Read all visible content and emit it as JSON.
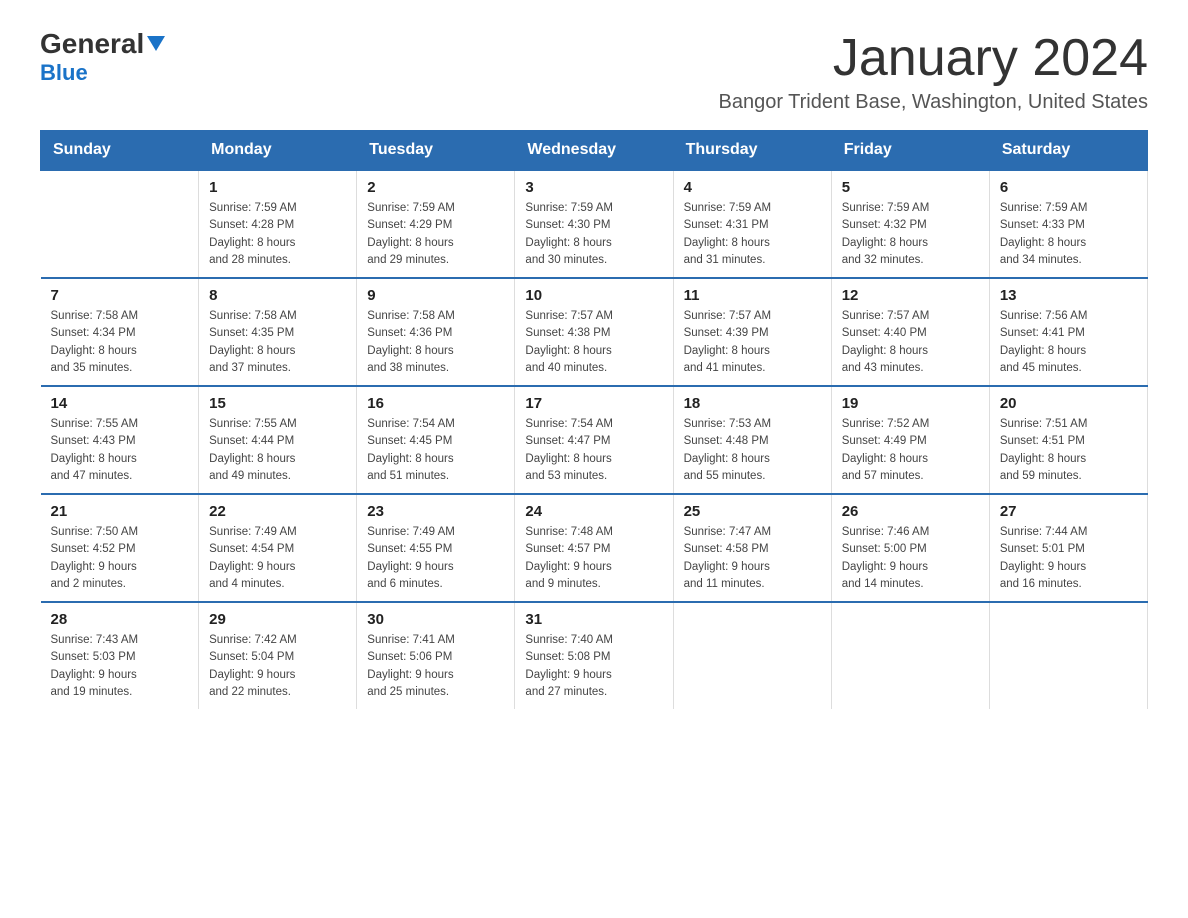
{
  "logo": {
    "part1": "General",
    "part2": "Blue"
  },
  "header": {
    "title": "January 2024",
    "subtitle": "Bangor Trident Base, Washington, United States"
  },
  "weekdays": [
    "Sunday",
    "Monday",
    "Tuesday",
    "Wednesday",
    "Thursday",
    "Friday",
    "Saturday"
  ],
  "weeks": [
    [
      {
        "day": "",
        "info": ""
      },
      {
        "day": "1",
        "info": "Sunrise: 7:59 AM\nSunset: 4:28 PM\nDaylight: 8 hours\nand 28 minutes."
      },
      {
        "day": "2",
        "info": "Sunrise: 7:59 AM\nSunset: 4:29 PM\nDaylight: 8 hours\nand 29 minutes."
      },
      {
        "day": "3",
        "info": "Sunrise: 7:59 AM\nSunset: 4:30 PM\nDaylight: 8 hours\nand 30 minutes."
      },
      {
        "day": "4",
        "info": "Sunrise: 7:59 AM\nSunset: 4:31 PM\nDaylight: 8 hours\nand 31 minutes."
      },
      {
        "day": "5",
        "info": "Sunrise: 7:59 AM\nSunset: 4:32 PM\nDaylight: 8 hours\nand 32 minutes."
      },
      {
        "day": "6",
        "info": "Sunrise: 7:59 AM\nSunset: 4:33 PM\nDaylight: 8 hours\nand 34 minutes."
      }
    ],
    [
      {
        "day": "7",
        "info": "Sunrise: 7:58 AM\nSunset: 4:34 PM\nDaylight: 8 hours\nand 35 minutes."
      },
      {
        "day": "8",
        "info": "Sunrise: 7:58 AM\nSunset: 4:35 PM\nDaylight: 8 hours\nand 37 minutes."
      },
      {
        "day": "9",
        "info": "Sunrise: 7:58 AM\nSunset: 4:36 PM\nDaylight: 8 hours\nand 38 minutes."
      },
      {
        "day": "10",
        "info": "Sunrise: 7:57 AM\nSunset: 4:38 PM\nDaylight: 8 hours\nand 40 minutes."
      },
      {
        "day": "11",
        "info": "Sunrise: 7:57 AM\nSunset: 4:39 PM\nDaylight: 8 hours\nand 41 minutes."
      },
      {
        "day": "12",
        "info": "Sunrise: 7:57 AM\nSunset: 4:40 PM\nDaylight: 8 hours\nand 43 minutes."
      },
      {
        "day": "13",
        "info": "Sunrise: 7:56 AM\nSunset: 4:41 PM\nDaylight: 8 hours\nand 45 minutes."
      }
    ],
    [
      {
        "day": "14",
        "info": "Sunrise: 7:55 AM\nSunset: 4:43 PM\nDaylight: 8 hours\nand 47 minutes."
      },
      {
        "day": "15",
        "info": "Sunrise: 7:55 AM\nSunset: 4:44 PM\nDaylight: 8 hours\nand 49 minutes."
      },
      {
        "day": "16",
        "info": "Sunrise: 7:54 AM\nSunset: 4:45 PM\nDaylight: 8 hours\nand 51 minutes."
      },
      {
        "day": "17",
        "info": "Sunrise: 7:54 AM\nSunset: 4:47 PM\nDaylight: 8 hours\nand 53 minutes."
      },
      {
        "day": "18",
        "info": "Sunrise: 7:53 AM\nSunset: 4:48 PM\nDaylight: 8 hours\nand 55 minutes."
      },
      {
        "day": "19",
        "info": "Sunrise: 7:52 AM\nSunset: 4:49 PM\nDaylight: 8 hours\nand 57 minutes."
      },
      {
        "day": "20",
        "info": "Sunrise: 7:51 AM\nSunset: 4:51 PM\nDaylight: 8 hours\nand 59 minutes."
      }
    ],
    [
      {
        "day": "21",
        "info": "Sunrise: 7:50 AM\nSunset: 4:52 PM\nDaylight: 9 hours\nand 2 minutes."
      },
      {
        "day": "22",
        "info": "Sunrise: 7:49 AM\nSunset: 4:54 PM\nDaylight: 9 hours\nand 4 minutes."
      },
      {
        "day": "23",
        "info": "Sunrise: 7:49 AM\nSunset: 4:55 PM\nDaylight: 9 hours\nand 6 minutes."
      },
      {
        "day": "24",
        "info": "Sunrise: 7:48 AM\nSunset: 4:57 PM\nDaylight: 9 hours\nand 9 minutes."
      },
      {
        "day": "25",
        "info": "Sunrise: 7:47 AM\nSunset: 4:58 PM\nDaylight: 9 hours\nand 11 minutes."
      },
      {
        "day": "26",
        "info": "Sunrise: 7:46 AM\nSunset: 5:00 PM\nDaylight: 9 hours\nand 14 minutes."
      },
      {
        "day": "27",
        "info": "Sunrise: 7:44 AM\nSunset: 5:01 PM\nDaylight: 9 hours\nand 16 minutes."
      }
    ],
    [
      {
        "day": "28",
        "info": "Sunrise: 7:43 AM\nSunset: 5:03 PM\nDaylight: 9 hours\nand 19 minutes."
      },
      {
        "day": "29",
        "info": "Sunrise: 7:42 AM\nSunset: 5:04 PM\nDaylight: 9 hours\nand 22 minutes."
      },
      {
        "day": "30",
        "info": "Sunrise: 7:41 AM\nSunset: 5:06 PM\nDaylight: 9 hours\nand 25 minutes."
      },
      {
        "day": "31",
        "info": "Sunrise: 7:40 AM\nSunset: 5:08 PM\nDaylight: 9 hours\nand 27 minutes."
      },
      {
        "day": "",
        "info": ""
      },
      {
        "day": "",
        "info": ""
      },
      {
        "day": "",
        "info": ""
      }
    ]
  ]
}
